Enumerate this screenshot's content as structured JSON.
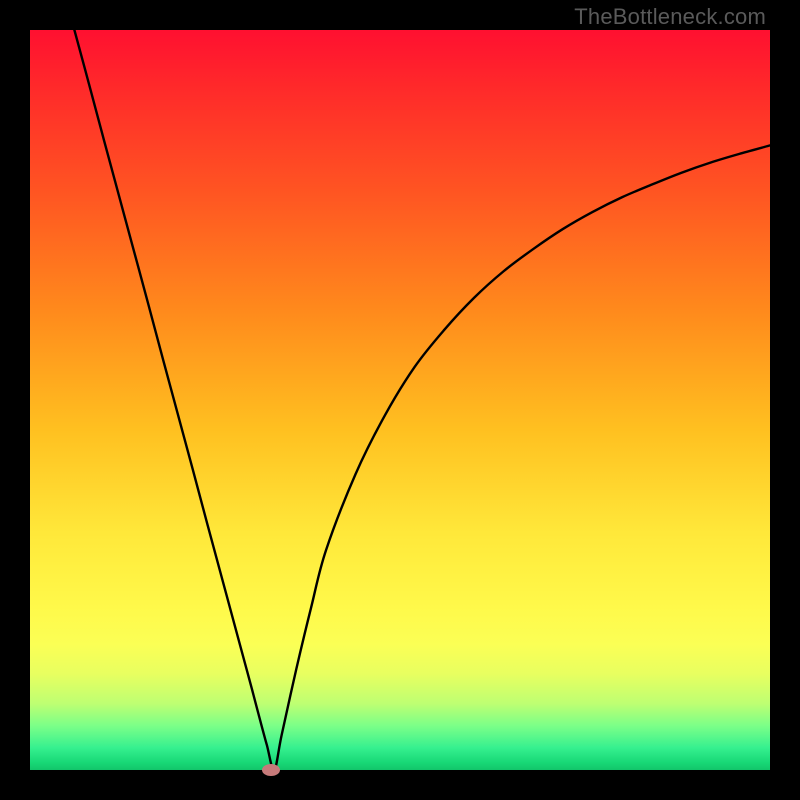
{
  "watermark": "TheBottleneck.com",
  "chart_data": {
    "type": "line",
    "title": "",
    "xlabel": "",
    "ylabel": "",
    "xlim": [
      0,
      100
    ],
    "ylim": [
      0,
      100
    ],
    "x": [
      6,
      8,
      10,
      12,
      14,
      16,
      18,
      20,
      22,
      24,
      26,
      28,
      29,
      30,
      31,
      32,
      33,
      34,
      36,
      38,
      40,
      44,
      48,
      52,
      56,
      60,
      64,
      68,
      72,
      76,
      80,
      84,
      88,
      92,
      96,
      100
    ],
    "y": [
      100,
      92.6,
      85.1,
      77.7,
      70.3,
      62.9,
      55.4,
      48.0,
      40.6,
      33.1,
      25.7,
      18.3,
      14.6,
      10.9,
      7.1,
      3.4,
      0,
      4.7,
      13.7,
      22.0,
      29.7,
      40.0,
      48.0,
      54.5,
      59.5,
      63.8,
      67.4,
      70.4,
      73.1,
      75.4,
      77.4,
      79.1,
      80.7,
      82.1,
      83.3,
      84.4
    ],
    "marker": {
      "x": 32.5,
      "y": 0
    },
    "background": {
      "gradient": "vertical",
      "stops": [
        {
          "pos": 0.0,
          "color": "#ff1030"
        },
        {
          "pos": 0.38,
          "color": "#ff8a1c"
        },
        {
          "pos": 0.68,
          "color": "#ffe83a"
        },
        {
          "pos": 0.95,
          "color": "#4cf58c"
        },
        {
          "pos": 1.0,
          "color": "#12c56a"
        }
      ]
    }
  }
}
